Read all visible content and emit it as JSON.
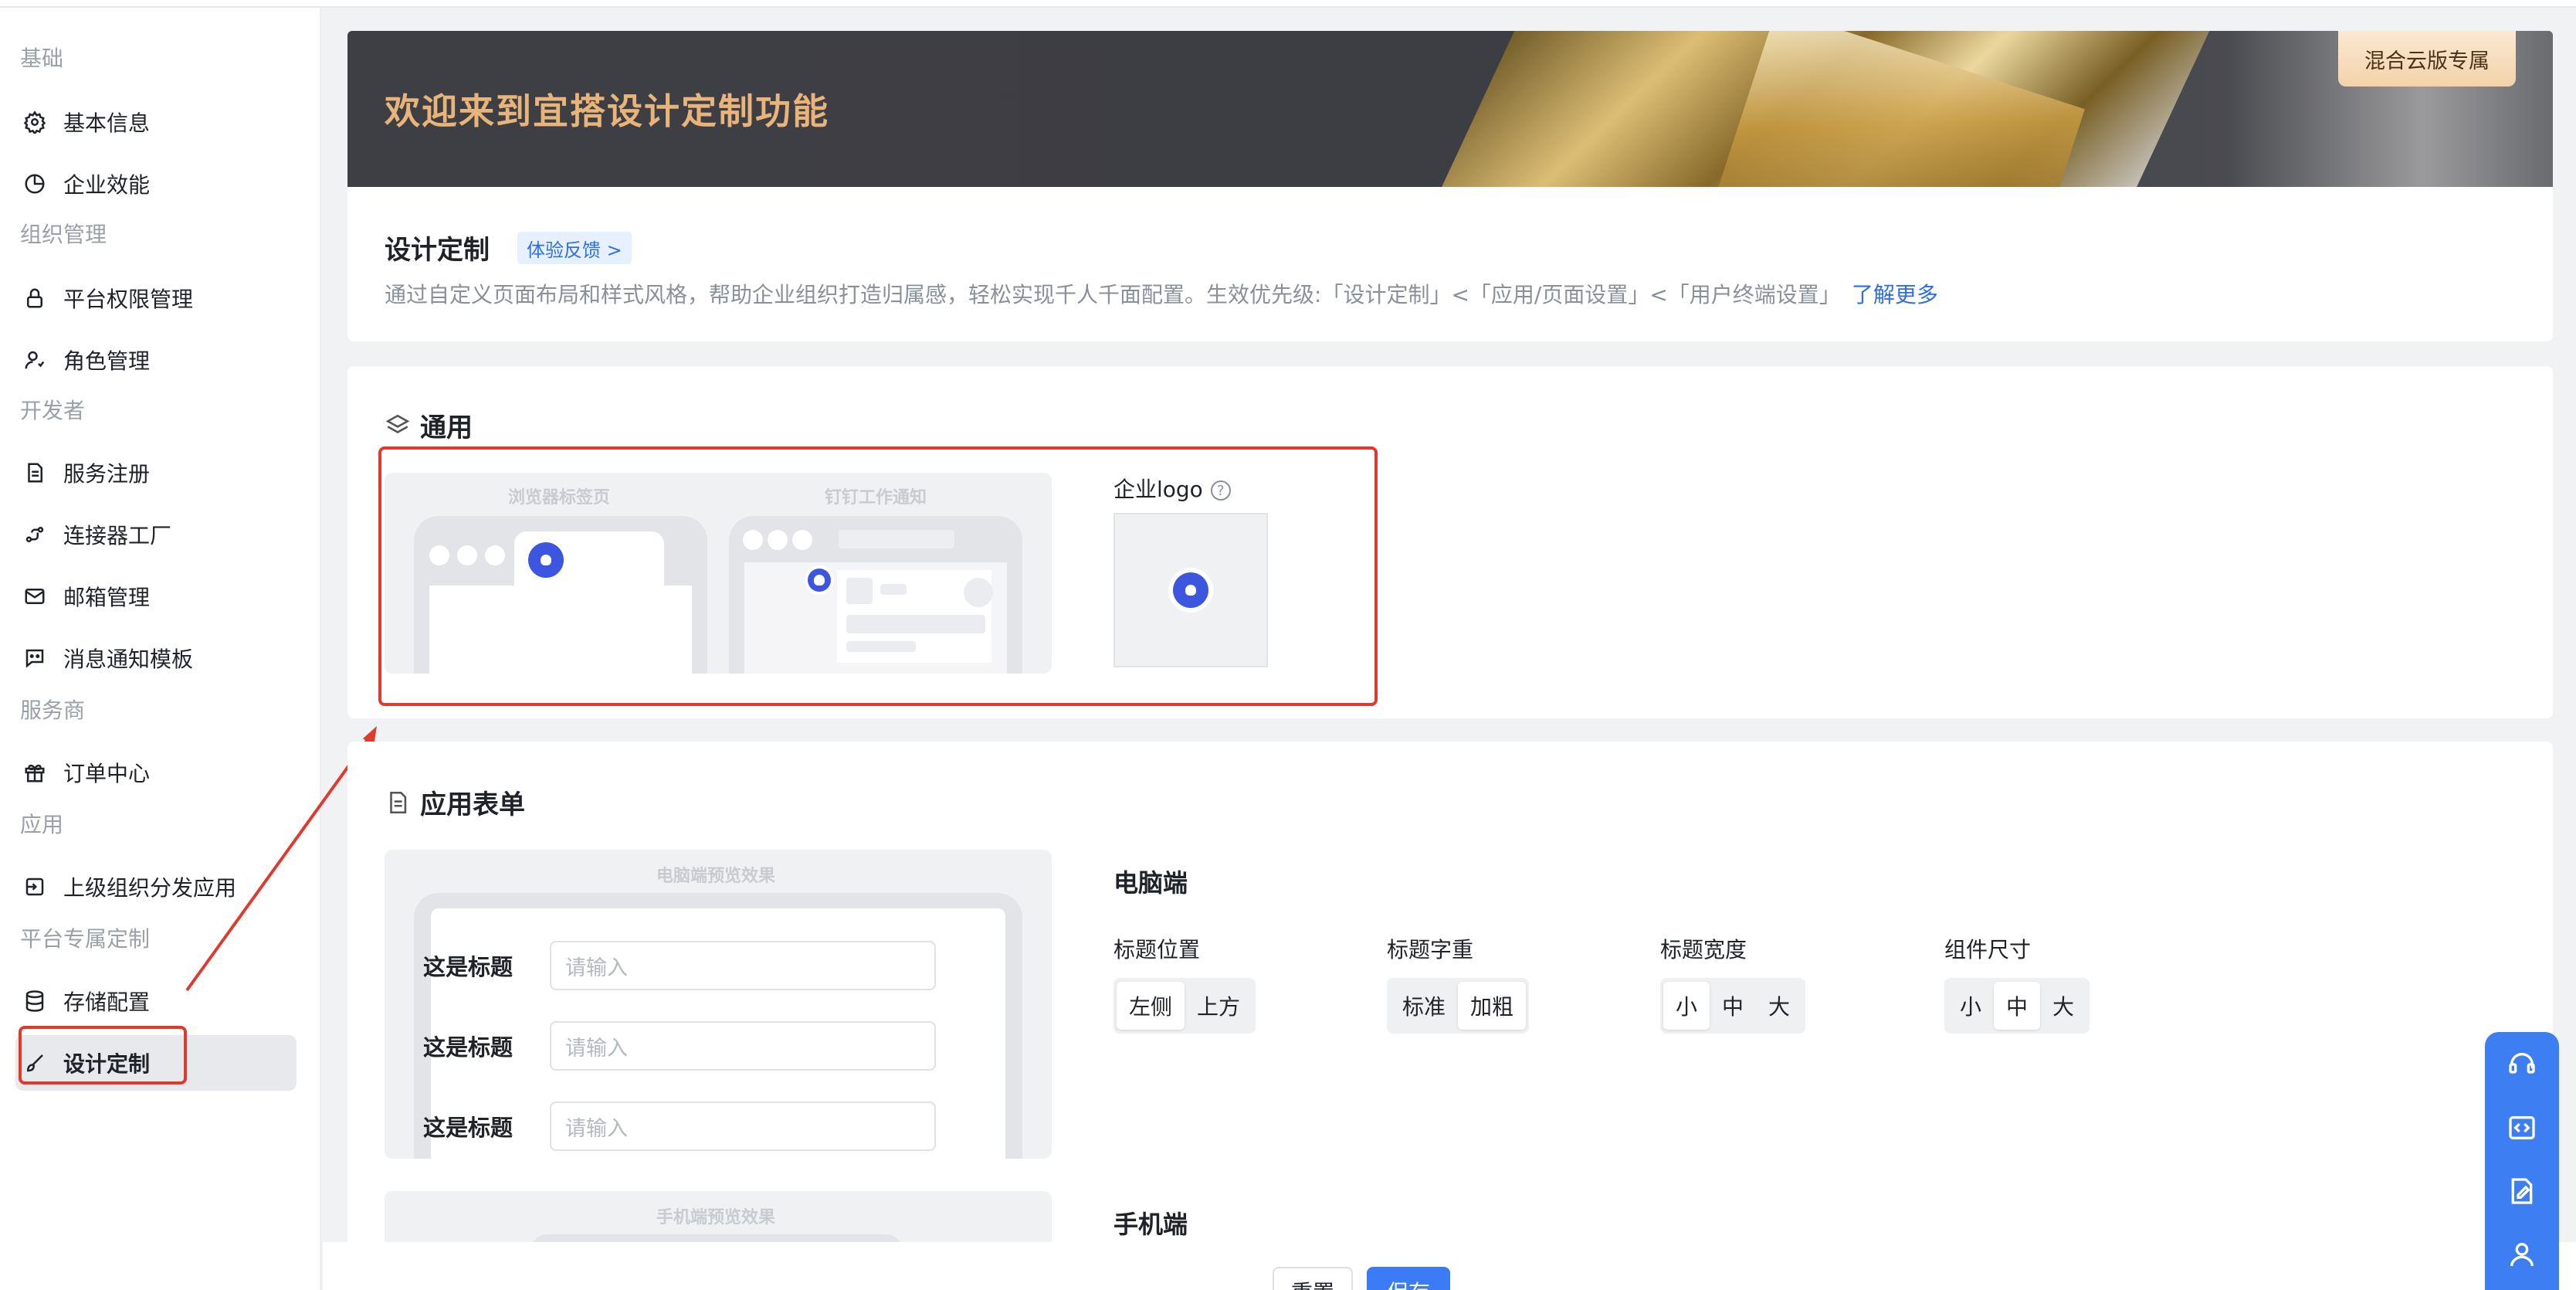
{
  "sidebar": {
    "sections": [
      {
        "title": "基础",
        "items": [
          {
            "label": "基本信息",
            "icon": "gear-icon"
          },
          {
            "label": "企业效能",
            "icon": "pie-chart-icon"
          }
        ]
      },
      {
        "title": "组织管理",
        "items": [
          {
            "label": "平台权限管理",
            "icon": "lock-icon"
          },
          {
            "label": "角色管理",
            "icon": "user-role-icon"
          }
        ]
      },
      {
        "title": "开发者",
        "items": [
          {
            "label": "服务注册",
            "icon": "document-icon"
          },
          {
            "label": "连接器工厂",
            "icon": "connector-icon"
          },
          {
            "label": "邮箱管理",
            "icon": "mail-icon"
          },
          {
            "label": "消息通知模板",
            "icon": "message-icon"
          }
        ]
      },
      {
        "title": "服务商",
        "items": [
          {
            "label": "订单中心",
            "icon": "gift-icon"
          }
        ]
      },
      {
        "title": "应用",
        "items": [
          {
            "label": "上级组织分发应用",
            "icon": "import-icon"
          }
        ]
      },
      {
        "title": "平台专属定制",
        "items": [
          {
            "label": "存储配置",
            "icon": "database-icon"
          },
          {
            "label": "设计定制",
            "icon": "brush-icon",
            "active": true
          }
        ]
      }
    ]
  },
  "banner": {
    "title": "欢迎来到宜搭设计定制功能",
    "badge": "混合云版专属"
  },
  "design": {
    "title": "设计定制",
    "feedback": "体验反馈 >",
    "description": "通过自定义页面布局和样式风格，帮助企业组织打造归属感，轻松实现千人千面配置。生效优先级:「设计定制」<「应用/页面设置」<「用户终端设置」",
    "learn_more": "了解更多"
  },
  "general": {
    "title": "通用",
    "preview_browser_label": "浏览器标签页",
    "preview_dingtalk_label": "钉钉工作通知",
    "logo_label": "企业logo"
  },
  "app_form": {
    "title": "应用表单",
    "pc_preview_label": "电脑端预览效果",
    "mobile_preview_label": "手机端预览效果",
    "rows": [
      {
        "label": "这是标题",
        "placeholder": "请输入"
      },
      {
        "label": "这是标题",
        "placeholder": "请输入"
      },
      {
        "label": "这是标题",
        "placeholder": "请输入"
      }
    ],
    "pc_title": "电脑端",
    "mobile_title": "手机端",
    "options": {
      "title_position": {
        "label": "标题位置",
        "choices": [
          "左侧",
          "上方"
        ],
        "selected": "左侧"
      },
      "title_weight": {
        "label": "标题字重",
        "choices": [
          "标准",
          "加粗"
        ],
        "selected": "加粗"
      },
      "title_width": {
        "label": "标题宽度",
        "choices": [
          "小",
          "中",
          "大"
        ],
        "selected": "小"
      },
      "component_size": {
        "label": "组件尺寸",
        "choices": [
          "小",
          "中",
          "大"
        ],
        "selected": "中"
      }
    }
  },
  "actions": {
    "reset": "重置",
    "save": "保存"
  },
  "colors": {
    "accent": "#3b7cf6",
    "annotation": "#e03a2f",
    "banner_text": "#e8b47a"
  }
}
